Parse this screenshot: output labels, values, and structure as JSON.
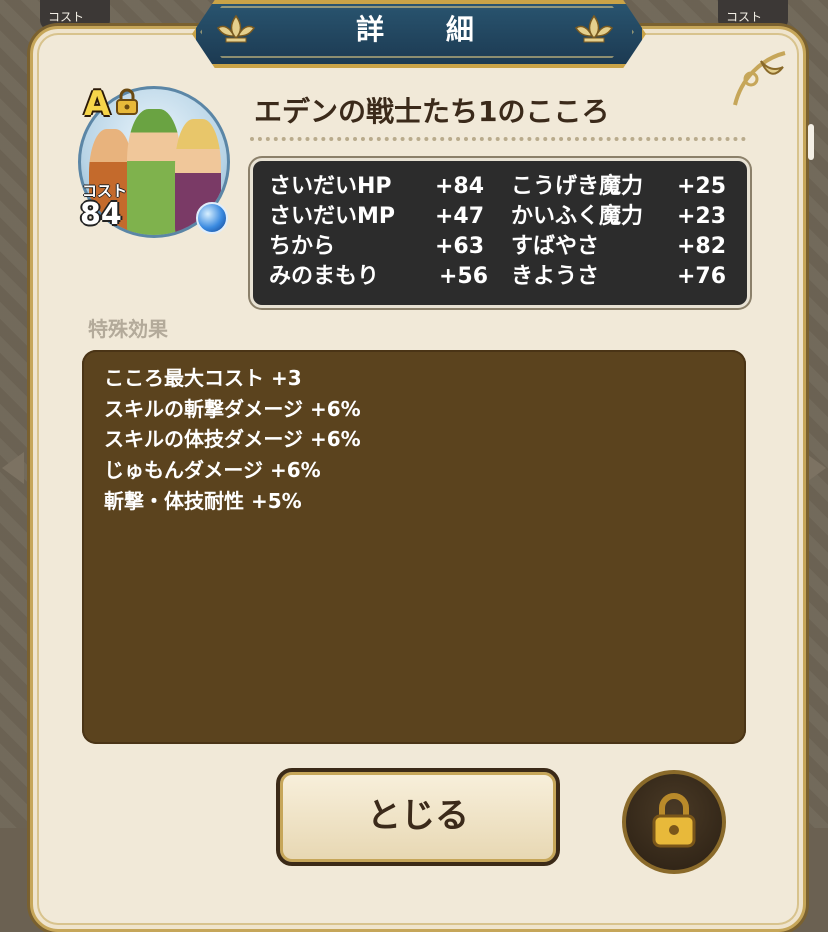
{
  "background": {
    "left_chip_text": "コスト",
    "right_chip_text": "コスト"
  },
  "dialog": {
    "title": "詳 細",
    "heart": {
      "rank": "A",
      "cost_label": "コスト",
      "cost_value": "84",
      "name": "エデンの戦士たち1のこころ"
    },
    "stats": [
      {
        "label": "さいだいHP",
        "value": "+84"
      },
      {
        "label": "さいだいMP",
        "value": "+47"
      },
      {
        "label": "ちから",
        "value": "+63"
      },
      {
        "label": "みのまもり",
        "value": "+56"
      },
      {
        "label": "こうげき魔力",
        "value": "+25"
      },
      {
        "label": "かいふく魔力",
        "value": "+23"
      },
      {
        "label": "すばやさ",
        "value": "+82"
      },
      {
        "label": "きようさ",
        "value": "+76"
      }
    ],
    "effects_title": "特殊効果",
    "effects": [
      "こころ最大コスト +3",
      "スキルの斬撃ダメージ +6%",
      "スキルの体技ダメージ +6%",
      "じゅもんダメージ +6%",
      "斬撃・体技耐性 +5%"
    ],
    "close_label": "とじる",
    "icons": {
      "rank_lock": "lock-icon",
      "element_orb": "orb-icon",
      "lock_button": "lock-icon",
      "ornament": "fleur-de-lis-icon"
    },
    "colors": {
      "panel_bg": "#f1e9d8",
      "banner": "#1c3a52",
      "gold": "#c9a347",
      "stats_bg": "#2c2c2c",
      "effects_bg": "#5b431e"
    }
  }
}
